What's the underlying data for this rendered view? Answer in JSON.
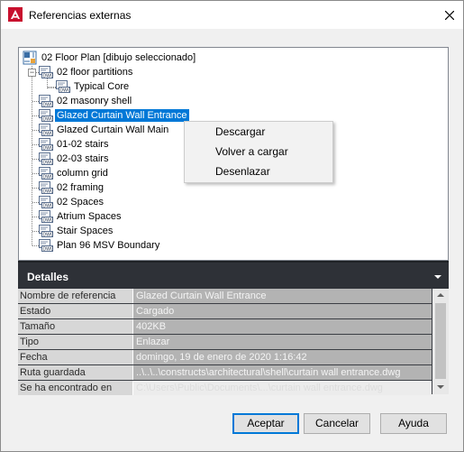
{
  "window": {
    "title": "Referencias externas"
  },
  "tree": {
    "root": {
      "label": "02 Floor Plan [dibujo seleccionado]"
    },
    "items": [
      {
        "label": "02 floor partitions",
        "expanded": true
      },
      {
        "label": "Typical Core",
        "child": true
      },
      {
        "label": "02 masonry shell"
      },
      {
        "label": "Glazed Curtain Wall Entrance",
        "selected": true
      },
      {
        "label": "Glazed Curtain Wall Main"
      },
      {
        "label": "01-02 stairs"
      },
      {
        "label": "02-03 stairs"
      },
      {
        "label": "column grid"
      },
      {
        "label": "02 framing"
      },
      {
        "label": "02 Spaces"
      },
      {
        "label": "Atrium Spaces"
      },
      {
        "label": "Stair Spaces"
      },
      {
        "label": "Plan 96 MSV Boundary"
      }
    ],
    "file_icon_text": "DWG"
  },
  "context_menu": {
    "items": [
      "Descargar",
      "Volver a cargar",
      "Desenlazar"
    ]
  },
  "details": {
    "title": "Detalles",
    "rows": [
      {
        "key": "Nombre de referencia",
        "value": "Glazed Curtain Wall Entrance"
      },
      {
        "key": "Estado",
        "value": "Cargado"
      },
      {
        "key": "Tamaño",
        "value": "402KB"
      },
      {
        "key": "Tipo",
        "value": "Enlazar"
      },
      {
        "key": "Fecha",
        "value": "domingo, 19 de enero de 2020  1:16:42"
      },
      {
        "key": "Ruta guardada",
        "value": "..\\..\\..\\constructs\\architectural\\shell\\curtain wall entrance.dwg"
      },
      {
        "key": "Se ha encontrado en",
        "value": "C:\\Users\\Public\\Documents\\...\\curtain wall entrance.dwg"
      }
    ]
  },
  "buttons": {
    "accept": "Aceptar",
    "cancel": "Cancelar",
    "help": "Ayuda"
  },
  "colors": {
    "selection": "#0078d7",
    "app_icon_red": "#c8102e",
    "details_header": "#2e3137"
  },
  "icons": {
    "app": "autocad-logo-icon",
    "close": "close-icon",
    "file": "dwg-file-icon",
    "root": "drawing-icon",
    "collapse": "minus-expander-icon",
    "details_toggle": "chevron-down-icon"
  }
}
